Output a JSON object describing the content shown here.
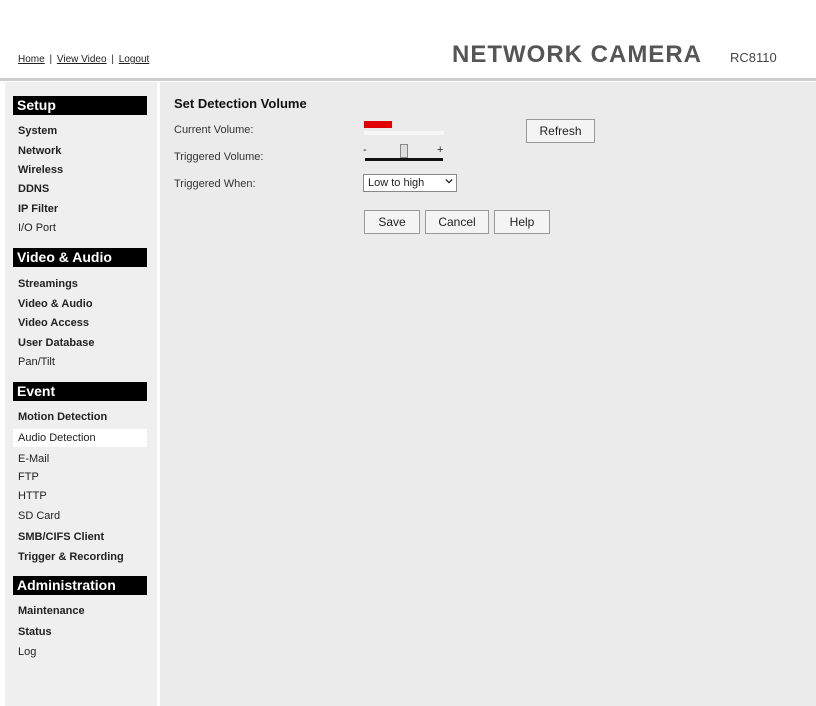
{
  "header": {
    "links": [
      "Home",
      "View Video",
      "Logout"
    ],
    "separator": "|",
    "brand": "NETWORK CAMERA",
    "model": "RC8110"
  },
  "sidebar": {
    "sections": [
      {
        "title": "Setup",
        "items": [
          "System",
          "Network",
          "Wireless",
          "DDNS",
          "IP Filter",
          "I/O Port"
        ]
      },
      {
        "title": "Video & Audio",
        "items": [
          "Streamings",
          "Video & Audio",
          "Video Access",
          "User Database",
          "Pan/Tilt"
        ]
      },
      {
        "title": "Event",
        "items": [
          "Motion Detection",
          "Audio Detection",
          "E-Mail",
          "FTP",
          "HTTP",
          "SD Card",
          "SMB/CIFS Client",
          "Trigger & Recording"
        ]
      },
      {
        "title": "Administration",
        "items": [
          "Maintenance",
          "Status",
          "Log"
        ]
      }
    ],
    "active_item": "Audio Detection"
  },
  "main": {
    "title": "Set Detection Volume",
    "current_volume_label": "Current Volume:",
    "triggered_volume_label": "Triggered Volume:",
    "triggered_when_label": "Triggered When:",
    "refresh_label": "Refresh",
    "slider_minus": "-",
    "slider_plus": "+",
    "current_volume_level": 0.35,
    "triggered_volume_level": 0.5,
    "triggered_when_value": "Low to high",
    "save_label": "Save",
    "cancel_label": "Cancel",
    "help_label": "Help"
  },
  "colors": {
    "section_bg": "#000000",
    "volume_indicator": "#e00000",
    "sidebar_bg": "#efefef",
    "content_bg": "#ebebeb"
  }
}
